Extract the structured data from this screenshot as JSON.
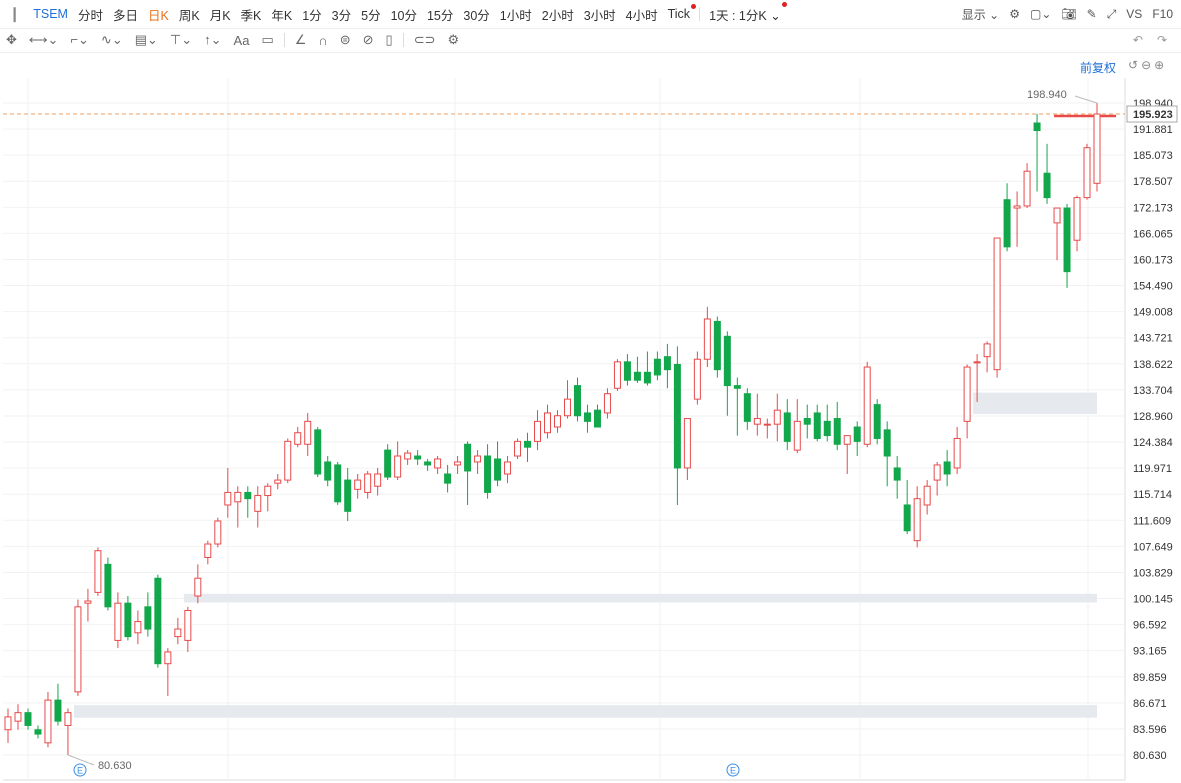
{
  "toolbar": {
    "symbol": "TSEM",
    "periods": [
      "分时",
      "多日",
      "日K",
      "周K",
      "月K",
      "季K",
      "年K",
      "1分",
      "3分",
      "5分",
      "10分",
      "15分",
      "30分",
      "1小时",
      "2小时",
      "3小时",
      "4小时",
      "Tick"
    ],
    "active_period": "日K",
    "interval_select": "1天 : 1分K",
    "display_label": "显示",
    "vs_label": "VS",
    "f10_label": "F10"
  },
  "adjust_label": "前复权",
  "colors": {
    "up": "#e84a4a",
    "down": "#12a74a",
    "accent": "#1f6fd6",
    "active": "#e8701a",
    "last_line": "#e84a4a",
    "dash": "#f0a060"
  },
  "chart_data": {
    "type": "candlestick",
    "y_axis_ticks": [
      "198.940",
      "195.923",
      "191.881",
      "185.073",
      "178.507",
      "172.173",
      "166.065",
      "160.173",
      "154.490",
      "149.008",
      "143.721",
      "138.622",
      "133.704",
      "128.960",
      "124.384",
      "119.971",
      "115.714",
      "111.609",
      "107.649",
      "103.829",
      "100.145",
      "96.592",
      "93.165",
      "89.859",
      "86.671",
      "83.596",
      "80.630"
    ],
    "y_scale": "log",
    "ylim": [
      80.63,
      198.94
    ],
    "last_price": "195.923",
    "high_label": "198.940",
    "low_label": "80.630",
    "event_marker": "E",
    "candles": [
      {
        "o": 83.5,
        "h": 86.0,
        "l": 82.0,
        "c": 85.0
      },
      {
        "o": 84.5,
        "h": 86.5,
        "l": 83.5,
        "c": 85.5
      },
      {
        "o": 85.5,
        "h": 86.0,
        "l": 83.5,
        "c": 84.0
      },
      {
        "o": 83.5,
        "h": 84.0,
        "l": 82.5,
        "c": 83.0
      },
      {
        "o": 82.0,
        "h": 88.0,
        "l": 81.5,
        "c": 87.0
      },
      {
        "o": 87.0,
        "h": 89.0,
        "l": 84.0,
        "c": 84.5
      },
      {
        "o": 84.0,
        "h": 86.0,
        "l": 80.63,
        "c": 85.5
      },
      {
        "o": 88.0,
        "h": 100.0,
        "l": 87.5,
        "c": 99.0
      },
      {
        "o": 99.5,
        "h": 101.5,
        "l": 97.0,
        "c": 99.8
      },
      {
        "o": 101.0,
        "h": 107.5,
        "l": 100.5,
        "c": 107.0
      },
      {
        "o": 105.0,
        "h": 106.0,
        "l": 98.5,
        "c": 99.0
      },
      {
        "o": 94.5,
        "h": 101.0,
        "l": 93.5,
        "c": 99.5
      },
      {
        "o": 99.5,
        "h": 100.5,
        "l": 94.5,
        "c": 95.0
      },
      {
        "o": 95.5,
        "h": 98.5,
        "l": 94.0,
        "c": 97.0
      },
      {
        "o": 99.0,
        "h": 101.0,
        "l": 95.0,
        "c": 96.0
      },
      {
        "o": 103.0,
        "h": 103.5,
        "l": 91.0,
        "c": 91.5
      },
      {
        "o": 91.5,
        "h": 93.5,
        "l": 87.5,
        "c": 93.0
      },
      {
        "o": 95.0,
        "h": 97.5,
        "l": 94.0,
        "c": 96.0
      },
      {
        "o": 94.5,
        "h": 99.0,
        "l": 93.0,
        "c": 98.5
      },
      {
        "o": 100.5,
        "h": 105.0,
        "l": 99.5,
        "c": 103.0
      },
      {
        "o": 106.0,
        "h": 108.5,
        "l": 105.0,
        "c": 108.0
      },
      {
        "o": 108.0,
        "h": 112.0,
        "l": 107.5,
        "c": 111.5
      },
      {
        "o": 114.0,
        "h": 120.0,
        "l": 112.0,
        "c": 116.0
      },
      {
        "o": 114.5,
        "h": 117.0,
        "l": 110.5,
        "c": 116.0
      },
      {
        "o": 116.0,
        "h": 117.0,
        "l": 112.0,
        "c": 115.0
      },
      {
        "o": 113.0,
        "h": 117.0,
        "l": 110.5,
        "c": 115.5
      },
      {
        "o": 115.5,
        "h": 117.5,
        "l": 113.0,
        "c": 117.0
      },
      {
        "o": 117.5,
        "h": 119.0,
        "l": 116.5,
        "c": 118.0
      },
      {
        "o": 118.0,
        "h": 125.0,
        "l": 117.5,
        "c": 124.5
      },
      {
        "o": 124.0,
        "h": 127.0,
        "l": 123.5,
        "c": 126.0
      },
      {
        "o": 124.0,
        "h": 129.5,
        "l": 122.0,
        "c": 128.0
      },
      {
        "o": 126.5,
        "h": 127.0,
        "l": 118.5,
        "c": 119.0
      },
      {
        "o": 121.0,
        "h": 122.0,
        "l": 117.0,
        "c": 118.0
      },
      {
        "o": 120.5,
        "h": 121.0,
        "l": 114.0,
        "c": 114.5
      },
      {
        "o": 118.0,
        "h": 120.0,
        "l": 111.5,
        "c": 113.0
      },
      {
        "o": 116.5,
        "h": 119.0,
        "l": 115.0,
        "c": 118.0
      },
      {
        "o": 116.0,
        "h": 119.5,
        "l": 115.0,
        "c": 119.0
      },
      {
        "o": 117.0,
        "h": 120.0,
        "l": 115.5,
        "c": 119.0
      },
      {
        "o": 123.0,
        "h": 124.0,
        "l": 118.0,
        "c": 118.5
      },
      {
        "o": 118.5,
        "h": 124.5,
        "l": 118.0,
        "c": 122.0
      },
      {
        "o": 121.5,
        "h": 123.0,
        "l": 120.5,
        "c": 122.5
      },
      {
        "o": 122.0,
        "h": 123.0,
        "l": 120.5,
        "c": 121.5
      },
      {
        "o": 121.0,
        "h": 121.5,
        "l": 119.5,
        "c": 120.5
      },
      {
        "o": 120.0,
        "h": 122.0,
        "l": 119.0,
        "c": 121.5
      },
      {
        "o": 119.0,
        "h": 120.5,
        "l": 116.0,
        "c": 117.5
      },
      {
        "o": 120.5,
        "h": 122.0,
        "l": 119.0,
        "c": 121.0
      },
      {
        "o": 124.0,
        "h": 124.5,
        "l": 114.0,
        "c": 119.5
      },
      {
        "o": 121.0,
        "h": 123.0,
        "l": 119.0,
        "c": 122.0
      },
      {
        "o": 122.0,
        "h": 124.0,
        "l": 115.0,
        "c": 116.0
      },
      {
        "o": 121.5,
        "h": 124.5,
        "l": 117.0,
        "c": 118.0
      },
      {
        "o": 119.0,
        "h": 122.0,
        "l": 117.5,
        "c": 121.0
      },
      {
        "o": 122.0,
        "h": 125.0,
        "l": 121.5,
        "c": 124.5
      },
      {
        "o": 124.5,
        "h": 126.0,
        "l": 121.0,
        "c": 123.5
      },
      {
        "o": 124.5,
        "h": 130.0,
        "l": 123.0,
        "c": 128.0
      },
      {
        "o": 126.0,
        "h": 131.0,
        "l": 125.0,
        "c": 129.5
      },
      {
        "o": 127.0,
        "h": 130.0,
        "l": 126.0,
        "c": 129.0
      },
      {
        "o": 129.0,
        "h": 135.5,
        "l": 128.5,
        "c": 132.0
      },
      {
        "o": 134.5,
        "h": 136.0,
        "l": 128.0,
        "c": 129.0
      },
      {
        "o": 129.5,
        "h": 131.0,
        "l": 126.0,
        "c": 128.0
      },
      {
        "o": 130.0,
        "h": 131.0,
        "l": 127.0,
        "c": 127.0
      },
      {
        "o": 129.5,
        "h": 134.0,
        "l": 128.5,
        "c": 133.0
      },
      {
        "o": 134.0,
        "h": 139.5,
        "l": 133.5,
        "c": 139.0
      },
      {
        "o": 139.0,
        "h": 140.5,
        "l": 134.5,
        "c": 135.5
      },
      {
        "o": 137.0,
        "h": 140.0,
        "l": 135.0,
        "c": 135.5
      },
      {
        "o": 137.0,
        "h": 141.0,
        "l": 134.5,
        "c": 135.0
      },
      {
        "o": 139.5,
        "h": 141.0,
        "l": 135.5,
        "c": 136.5
      },
      {
        "o": 140.0,
        "h": 142.5,
        "l": 134.0,
        "c": 137.5
      },
      {
        "o": 138.5,
        "h": 142.0,
        "l": 114.0,
        "c": 120.0
      },
      {
        "o": 120.0,
        "h": 125.0,
        "l": 118.0,
        "c": 128.5
      },
      {
        "o": 132.0,
        "h": 141.0,
        "l": 131.0,
        "c": 139.5
      },
      {
        "o": 139.5,
        "h": 150.0,
        "l": 138.0,
        "c": 147.5
      },
      {
        "o": 147.0,
        "h": 148.0,
        "l": 136.0,
        "c": 137.5
      },
      {
        "o": 144.0,
        "h": 145.0,
        "l": 129.0,
        "c": 134.5
      },
      {
        "o": 134.5,
        "h": 136.0,
        "l": 125.5,
        "c": 134.0
      },
      {
        "o": 133.0,
        "h": 134.0,
        "l": 126.5,
        "c": 128.0
      },
      {
        "o": 127.5,
        "h": 133.0,
        "l": 125.5,
        "c": 128.5
      },
      {
        "o": 127.5,
        "h": 128.5,
        "l": 125.0,
        "c": 127.5
      },
      {
        "o": 127.5,
        "h": 133.0,
        "l": 124.5,
        "c": 130.0
      },
      {
        "o": 129.5,
        "h": 132.0,
        "l": 123.0,
        "c": 124.5
      },
      {
        "o": 123.0,
        "h": 132.0,
        "l": 122.5,
        "c": 128.0
      },
      {
        "o": 128.5,
        "h": 131.0,
        "l": 125.0,
        "c": 127.5
      },
      {
        "o": 129.5,
        "h": 131.0,
        "l": 124.5,
        "c": 125.0
      },
      {
        "o": 128.0,
        "h": 131.0,
        "l": 124.5,
        "c": 125.5
      },
      {
        "o": 128.5,
        "h": 131.5,
        "l": 123.0,
        "c": 124.0
      },
      {
        "o": 124.0,
        "h": 125.0,
        "l": 119.0,
        "c": 125.5
      },
      {
        "o": 127.0,
        "h": 128.0,
        "l": 122.0,
        "c": 124.5
      },
      {
        "o": 124.0,
        "h": 139.0,
        "l": 123.5,
        "c": 138.0
      },
      {
        "o": 131.0,
        "h": 132.0,
        "l": 124.0,
        "c": 125.0
      },
      {
        "o": 126.5,
        "h": 128.0,
        "l": 117.0,
        "c": 122.0
      },
      {
        "o": 120.0,
        "h": 122.0,
        "l": 115.0,
        "c": 118.0
      },
      {
        "o": 114.0,
        "h": 118.0,
        "l": 109.5,
        "c": 110.0
      },
      {
        "o": 108.5,
        "h": 117.0,
        "l": 107.5,
        "c": 115.0
      },
      {
        "o": 114.0,
        "h": 118.0,
        "l": 112.5,
        "c": 117.0
      },
      {
        "o": 118.0,
        "h": 121.0,
        "l": 115.5,
        "c": 120.5
      },
      {
        "o": 121.0,
        "h": 123.0,
        "l": 117.0,
        "c": 119.0
      },
      {
        "o": 120.0,
        "h": 127.0,
        "l": 119.0,
        "c": 125.0
      },
      {
        "o": 128.0,
        "h": 138.5,
        "l": 125.0,
        "c": 138.0
      },
      {
        "o": 139.0,
        "h": 140.5,
        "l": 131.5,
        "c": 139.0
      },
      {
        "o": 140.0,
        "h": 143.0,
        "l": 137.0,
        "c": 142.5
      },
      {
        "o": 137.5,
        "h": 149.0,
        "l": 136.0,
        "c": 165.0
      },
      {
        "o": 174.0,
        "h": 178.0,
        "l": 162.0,
        "c": 163.0
      },
      {
        "o": 172.0,
        "h": 176.0,
        "l": 163.0,
        "c": 172.5
      },
      {
        "o": 172.5,
        "h": 183.0,
        "l": 172.0,
        "c": 181.0
      },
      {
        "o": 193.5,
        "h": 196.0,
        "l": 176.0,
        "c": 191.5
      },
      {
        "o": 180.5,
        "h": 188.0,
        "l": 173.0,
        "c": 174.5
      },
      {
        "o": 168.5,
        "h": 170.0,
        "l": 160.0,
        "c": 172.0
      },
      {
        "o": 172.0,
        "h": 173.0,
        "l": 154.0,
        "c": 157.5
      },
      {
        "o": 164.5,
        "h": 175.0,
        "l": 162.0,
        "c": 174.5
      },
      {
        "o": 174.5,
        "h": 188.0,
        "l": 174.0,
        "c": 187.0
      },
      {
        "o": 178.0,
        "h": 198.94,
        "l": 176.0,
        "c": 195.923
      }
    ],
    "support_zones": [
      {
        "from": 86.4,
        "to": 84.9,
        "start_index": 7
      },
      {
        "from": 100.8,
        "to": 99.6,
        "start_index": 18
      },
      {
        "from": 133.2,
        "to": 129.3,
        "start_index": 97
      }
    ],
    "resistance_level": {
      "value": 195.923,
      "start_index": 105
    }
  }
}
